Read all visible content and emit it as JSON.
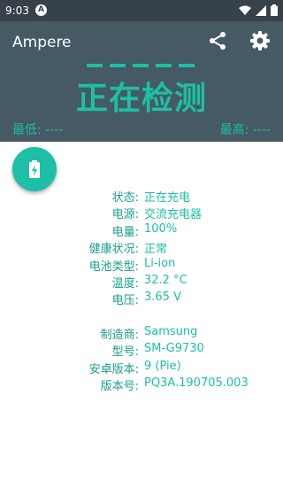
{
  "status_bar": {
    "time": "9:03",
    "app_badge": "A"
  },
  "app": {
    "title": "Ampere"
  },
  "toolbar": {
    "share_icon": "share-icon",
    "settings_icon": "gear-icon"
  },
  "monitor": {
    "state_text": "正在检测",
    "min_label": "最低: ----",
    "max_label": "最高: ----"
  },
  "fab": {
    "icon": "battery-charging-icon"
  },
  "battery_info": [
    {
      "label": "状态:",
      "value": "正在充电"
    },
    {
      "label": "电源:",
      "value": "交流充电器"
    },
    {
      "label": "电量:",
      "value": "100%"
    },
    {
      "label": "健康状况:",
      "value": "正常"
    },
    {
      "label": "电池类型:",
      "value": "Li-ion"
    },
    {
      "label": "温度:",
      "value": "32.2 °C"
    },
    {
      "label": "电压:",
      "value": "3.65 V"
    }
  ],
  "device_info": [
    {
      "label": "制造商:",
      "value": "Samsung"
    },
    {
      "label": "型号:",
      "value": "SM-G9730"
    },
    {
      "label": "安卓版本:",
      "value": "9 (Pie)"
    },
    {
      "label": "版本号:",
      "value": "PQ3A.190705.003"
    }
  ],
  "colors": {
    "accent": "#1dbfa6",
    "header": "#455a64",
    "status_bar": "#364149"
  }
}
